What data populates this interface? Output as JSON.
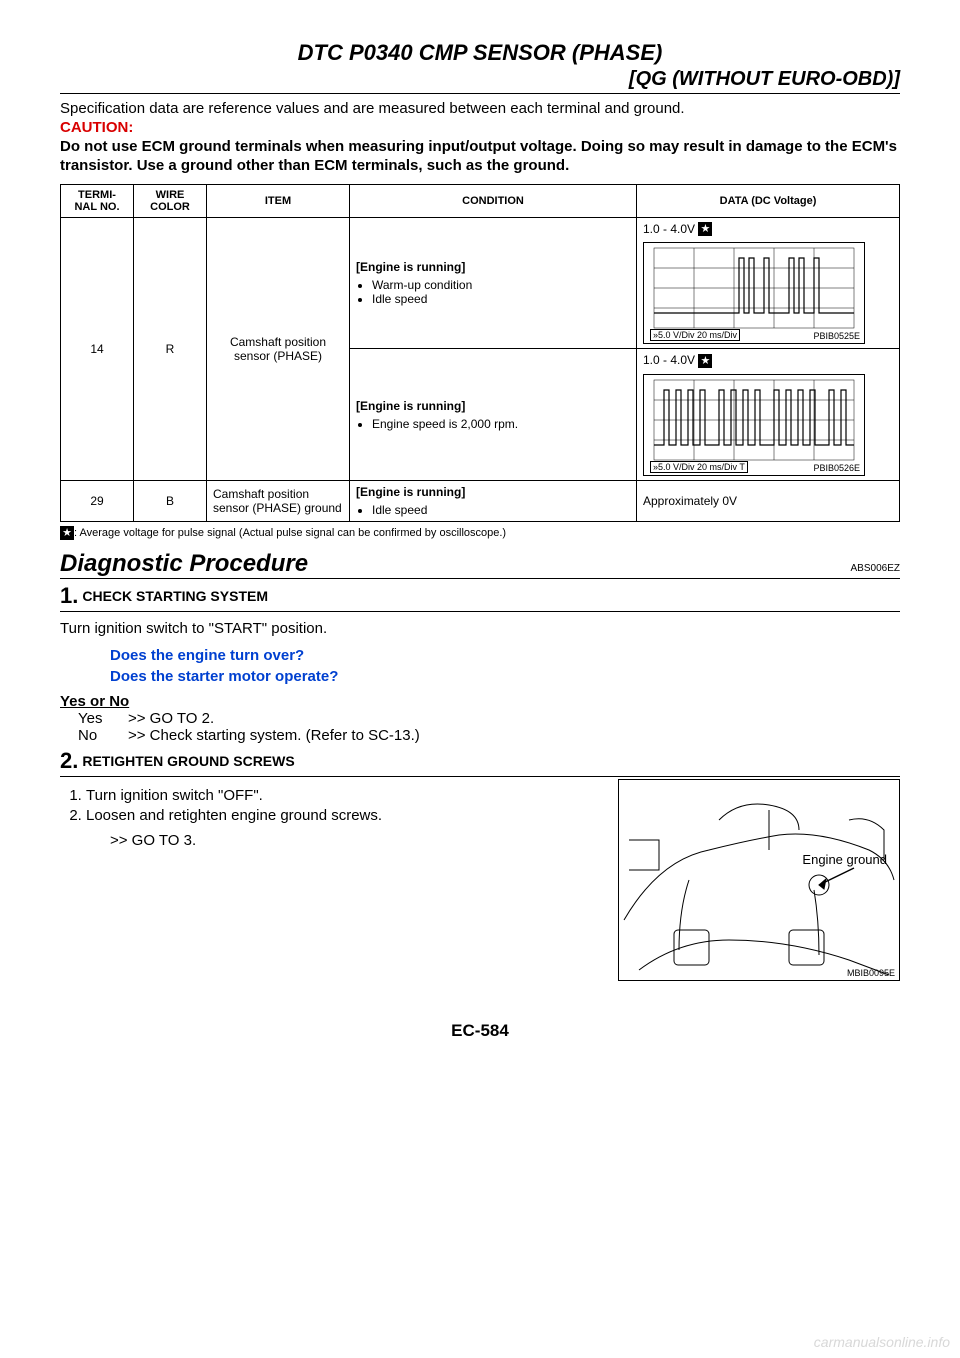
{
  "header": {
    "title": "DTC P0340 CMP SENSOR (PHASE)",
    "subtitle": "[QG (WITHOUT EURO-OBD)]"
  },
  "spec_note": "Specification data are reference values and are measured between each terminal and ground.",
  "caution_label": "CAUTION:",
  "caution_body": "Do not use ECM ground terminals when measuring input/output voltage. Doing so may result in damage to the ECM's transistor. Use a ground other than ECM terminals, such as the ground.",
  "table": {
    "headers": {
      "terminal": "TERMI-\nNAL\nNO.",
      "wire": "WIRE\nCOLOR",
      "item": "ITEM",
      "condition": "CONDITION",
      "data": "DATA (DC Voltage)"
    },
    "rows": [
      {
        "terminal": "14",
        "wire": "R",
        "item": "Camshaft position sensor (PHASE)",
        "subs": [
          {
            "cond_head": "[Engine is running]",
            "cond_bullets": [
              "Warm-up condition",
              "Idle speed"
            ],
            "data_head": "1.0 - 4.0V",
            "scope_scale": "5.0 V/Div    20 ms/Div",
            "scope_ref": "PBIB0525E"
          },
          {
            "cond_head": "[Engine is running]",
            "cond_bullets": [
              "Engine speed is 2,000 rpm."
            ],
            "data_head": "1.0 - 4.0V",
            "scope_scale": "5.0 V/Div    20 ms/Div",
            "scope_ref": "PBIB0526E"
          }
        ]
      },
      {
        "terminal": "29",
        "wire": "B",
        "item": "Camshaft position sensor (PHASE) ground",
        "cond_head": "[Engine is running]",
        "cond_bullets": [
          "Idle speed"
        ],
        "data": "Approximately 0V"
      }
    ],
    "star_note": ": Average voltage for pulse signal (Actual pulse signal can be confirmed by oscilloscope.)"
  },
  "procedure": {
    "heading": "Diagnostic Procedure",
    "ref": "ABS006EZ",
    "step1": {
      "title": "CHECK STARTING SYSTEM",
      "body": "Turn ignition switch to \"START\" position.",
      "q1": "Does the engine turn over?",
      "q2": "Does the starter motor operate?",
      "yn_head": "Yes or No",
      "yes": ">> GO TO 2.",
      "no": ">> Check starting system. (Refer to SC-13.)"
    },
    "step2": {
      "title": "RETIGHTEN GROUND SCREWS",
      "li1": "Turn ignition switch \"OFF\".",
      "li2": "Loosen and retighten engine ground screws.",
      "goto": ">> GO TO 3.",
      "fig_label": "Engine ground",
      "fig_ref": "MBIB0095E"
    }
  },
  "labels": {
    "yes": "Yes",
    "no": "No"
  },
  "footer": "EC-584",
  "watermark": "carmanualsonline.info"
}
